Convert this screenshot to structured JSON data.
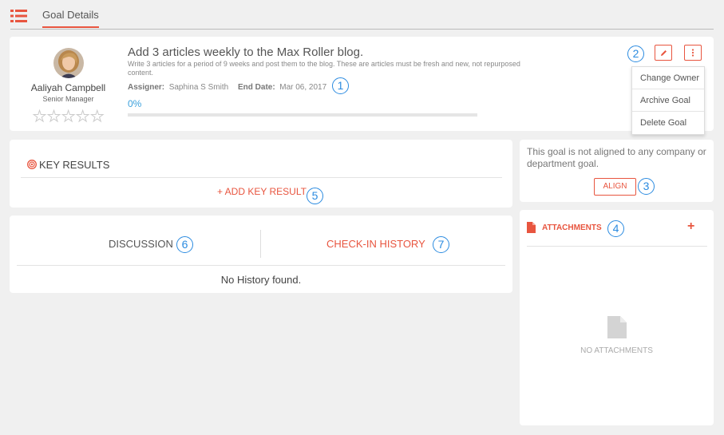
{
  "topbar": {
    "tab_label": "Goal Details",
    "menu_icon": "list-icon"
  },
  "goal": {
    "owner_name": "Aaliyah Campbell",
    "owner_role": "Senior Manager",
    "rating": 0,
    "rating_max": 5,
    "title": "Add 3 articles weekly to the Max Roller blog.",
    "description": "Write 3 articles for a period of 9 weeks and post them to the blog. These are articles must be fresh and new, not repurposed content.",
    "assigner_label": "Assigner:",
    "assigner": "Saphina S Smith",
    "end_date_label": "End Date:",
    "end_date": "Mar 06, 2017",
    "progress_text": "0%",
    "progress_value": 0
  },
  "actions": {
    "edit_icon": "pencil-icon",
    "more_icon": "vertical-dots-icon",
    "menu": [
      "Change Owner",
      "Archive Goal",
      "Delete Goal"
    ]
  },
  "key_results": {
    "title": "KEY RESULTS",
    "add_label": "+ ADD KEY RESULT",
    "icon": "target-icon"
  },
  "discussion": {
    "tab_discussion": "DISCUSSION",
    "tab_history": "CHECK-IN HISTORY",
    "empty": "No History found."
  },
  "align": {
    "text": "This goal is not aligned to any company or department goal.",
    "button": "ALIGN"
  },
  "attachments": {
    "title": "ATTACHMENTS",
    "add": "+",
    "empty": "NO ATTACHMENTS"
  },
  "callouts": [
    "1",
    "2",
    "3",
    "4",
    "5",
    "6",
    "7"
  ],
  "colors": {
    "accent": "#e8553f",
    "progress": "#3aa0dc",
    "callout": "#2b8be0"
  }
}
